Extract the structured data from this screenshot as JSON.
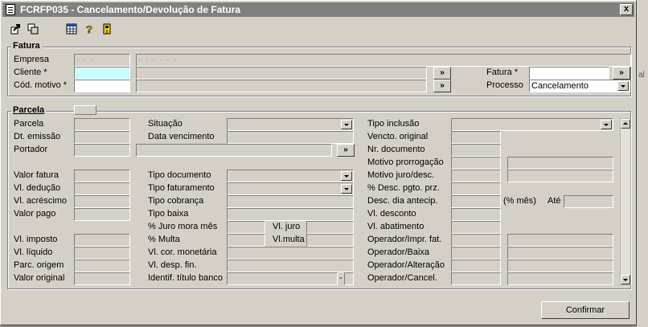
{
  "window": {
    "title": "FCRFP035 - Cancelamento/Devolução de Fatura",
    "close_label": "x"
  },
  "toolbar": {
    "icons": [
      "exit-icon",
      "copy-icon",
      "grid-icon",
      "help-icon",
      "door-icon"
    ]
  },
  "background": {
    "frag_1": "al"
  },
  "fatura": {
    "legend": "Fatura",
    "empresa_label": "Empresa",
    "empresa_code": "· · ·",
    "empresa_name": "· · · · · ·",
    "cliente_label": "Cliente *",
    "cod_motivo_label": "Cód. motivo *",
    "fatura_label": "Fatura *",
    "processo_label": "Processo",
    "processo_value": "Cancelamento",
    "lookup_label": "»"
  },
  "parcela": {
    "legend": "Parcela",
    "col1": {
      "parcela": "Parcela",
      "dt_emissao": "Dt. emissão",
      "portador": "Portador",
      "valor_fatura": "Valor fatura",
      "vl_deducao": "Vl. dedução",
      "vl_acrescimo": "Vl. acréscimo",
      "valor_pago": "Valor pago",
      "vl_imposto": "Vl. imposto",
      "vl_liquido": "Vl. líquido",
      "parc_origem": "Parc. origem",
      "valor_original": "Valor original"
    },
    "col2": {
      "situacao": "Situação",
      "data_vencimento": "Data vencimento",
      "tipo_documento": "Tipo documento",
      "tipo_faturamento": "Tipo faturamento",
      "tipo_cobranca": "Tipo cobrança",
      "tipo_baixa": "Tipo baixa",
      "juro_mora": "% Juro mora mês",
      "vl_juro": "Vl. juro",
      "multa": "% Multa",
      "vl_multa": "Vl.multa",
      "vl_cor_monetaria": "Vl. cor. monetária",
      "vl_desp_fin": "Vl. desp. fin.",
      "identif_titulo": "Identif. título banco",
      "identif_sep": "-"
    },
    "col3": {
      "tipo_inclusao": "Tipo inclusão",
      "vencto_original": "Vencto. original",
      "nr_documento": "Nr. documento",
      "motivo_prorrogacao": "Motivo prorrogação",
      "motivo_juro_desc": "Motivo juro/desc.",
      "desc_pgto_prz": "% Desc. pgto. prz.",
      "desc_dia_antecip": "Desc. dia antecip.",
      "pct_mes": "(% mês)",
      "ate": "Até",
      "vl_desconto": "Vl. desconto",
      "vl_abatimento": "Vl. abatimento",
      "operador_impr_fat": "Operador/Impr. fat.",
      "operador_baixa": "Operador/Baixa",
      "operador_alteracao": "Operador/Alteração",
      "operador_cancel": "Operador/Cancel."
    }
  },
  "footer": {
    "confirmar_label": "Confirmar"
  }
}
